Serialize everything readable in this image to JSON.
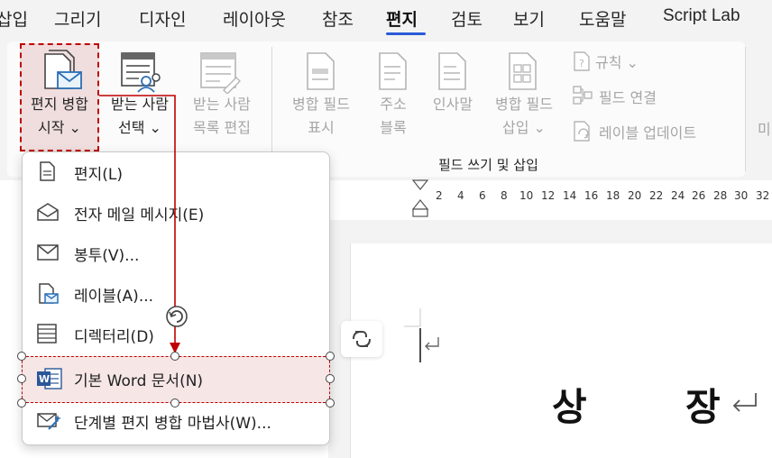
{
  "tabs": [
    "삽입",
    "그리기",
    "디자인",
    "레이아웃",
    "참조",
    "편지",
    "검토",
    "보기",
    "도움말",
    "Script Lab"
  ],
  "active_tab": "편지",
  "accent_color": "#2a5bd7",
  "annotation_color": "#c00000",
  "ribbon": {
    "start_merge": {
      "line1": "편지 병합",
      "line2": "시작 ⌄",
      "icon": "mail-merge-icon"
    },
    "select_recipients": {
      "line1": "받는 사람",
      "line2": "선택 ⌄",
      "icon": "recipients-icon"
    },
    "edit_recipients": {
      "line1": "받는 사람",
      "line2": "목록 편집",
      "icon": "edit-list-icon"
    },
    "highlight_fields": {
      "line1": "병합 필드",
      "line2": "표시",
      "icon": "highlight-fields-icon"
    },
    "address_block": {
      "line1": "주소",
      "line2": "블록",
      "icon": "address-block-icon"
    },
    "greeting": {
      "line1": "인사말",
      "icon": "greeting-icon"
    },
    "insert_field": {
      "line1": "병합 필드",
      "line2": "삽입 ⌄",
      "icon": "insert-field-icon"
    },
    "rules": "규칙 ⌄",
    "match_fields": "필드 연결",
    "update_labels": "레이블 업데이트",
    "group_label": "필드 쓰기 및 삽입",
    "next_group_cut": "미"
  },
  "ruler_ticks": [
    "2",
    "4",
    "6",
    "8",
    "10",
    "12",
    "14",
    "16",
    "18",
    "20",
    "22",
    "24",
    "26",
    "28",
    "30",
    "32"
  ],
  "dropdown": {
    "items": [
      {
        "label": "편지(L)",
        "icon": "letter-icon"
      },
      {
        "label": "전자 메일 메시지(E)",
        "icon": "email-icon"
      },
      {
        "label": "봉투(V)...",
        "icon": "envelope-icon"
      },
      {
        "label": "레이블(A)...",
        "icon": "label-icon"
      },
      {
        "label": "디렉터리(D)",
        "icon": "directory-icon"
      },
      {
        "label": "기본 Word 문서(N)",
        "icon": "word-document-icon"
      },
      {
        "label": "단계별 편지 병합 마법사(W)...",
        "icon": "wizard-icon"
      }
    ]
  },
  "document": {
    "char1": "상",
    "char2": "장"
  }
}
